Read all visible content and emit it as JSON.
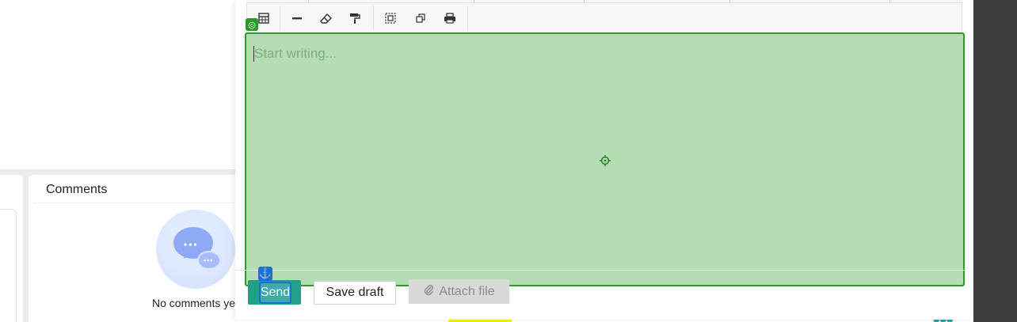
{
  "editor": {
    "placeholder": "Start writing..."
  },
  "toolbar": {
    "buttons": [
      {
        "name": "table-icon",
        "glyph": "▦"
      },
      {
        "name": "horizontal-rule-icon",
        "glyph": "━"
      },
      {
        "name": "eraser-icon",
        "glyph": "⌫"
      },
      {
        "name": "paint-roller-icon",
        "glyph": "🖌"
      },
      {
        "name": "select-all-icon",
        "glyph": "⊡"
      },
      {
        "name": "duplicate-icon",
        "glyph": "⧉"
      },
      {
        "name": "print-icon",
        "glyph": "🖶"
      }
    ]
  },
  "actions": {
    "send_label": "Send",
    "save_draft_label": "Save draft",
    "attach_label": "Attach file"
  },
  "comments": {
    "title": "Comments",
    "empty_text": "No comments yet"
  },
  "colors": {
    "editor_highlight": "#b4ddb4",
    "editor_border": "#2e9b2e",
    "send_button": "#21a08a",
    "selection_blue": "#1b6fd6"
  }
}
